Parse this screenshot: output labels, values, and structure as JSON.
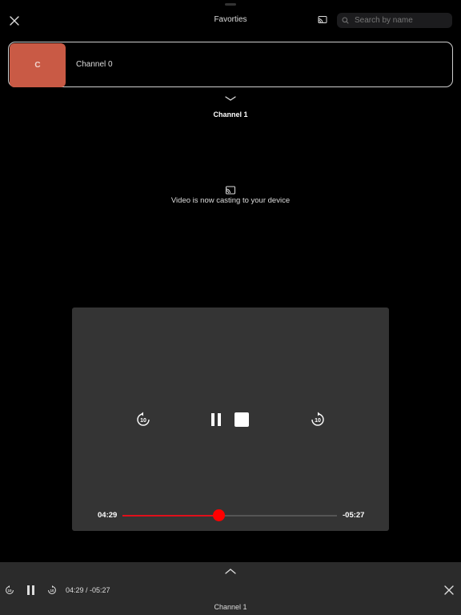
{
  "header": {
    "title": "Favorties",
    "search_placeholder": "Search by name",
    "icons": {
      "close": "close-icon",
      "cast": "cast-icon",
      "search": "search-icon"
    }
  },
  "channel_list": {
    "items": [
      {
        "thumbnail_letter": "C",
        "name": "Channel 0",
        "thumbnail_color": "#c95a45"
      }
    ]
  },
  "player": {
    "channel_title": "Channel 1",
    "cast_message": "Video is now casting to your device",
    "elapsed": "04:29",
    "remaining": "-05:27",
    "progress": 0.45,
    "skip_seconds": "10",
    "accent_color": "#ff0000"
  },
  "mini_player": {
    "time_display": "04:29 / -05:27",
    "channel_title": "Channel 1",
    "skip_seconds": "10"
  }
}
